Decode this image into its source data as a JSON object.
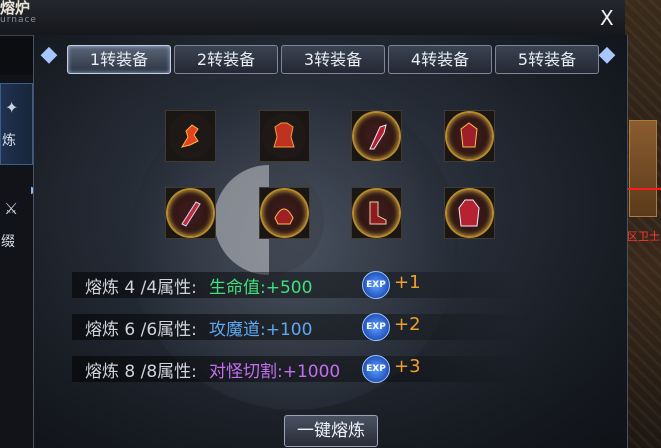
{
  "window": {
    "title": "熔炉",
    "subtitle": "urnace",
    "close_label": "X"
  },
  "sidebar": {
    "items": [
      {
        "label": "炼",
        "icon": "smelt-icon",
        "active": true
      },
      {
        "label": "缀",
        "icon": "embellish-icon",
        "active": false
      }
    ]
  },
  "tabs": [
    {
      "label": "1转装备",
      "active": true
    },
    {
      "label": "2转装备",
      "active": false
    },
    {
      "label": "3转装备",
      "active": false
    },
    {
      "label": "4转装备",
      "active": false
    },
    {
      "label": "5转装备",
      "active": false
    }
  ],
  "equipment_slots": [
    {
      "icon": "flame-weapon-icon",
      "highlight": false
    },
    {
      "icon": "red-armor-icon",
      "highlight": false
    },
    {
      "icon": "axe-icon",
      "highlight": true
    },
    {
      "icon": "armor-set-icon",
      "highlight": true
    },
    {
      "icon": "blade-icon",
      "highlight": true
    },
    {
      "icon": "helmet-icon",
      "highlight": true
    },
    {
      "icon": "boots-icon",
      "highlight": true
    },
    {
      "icon": "robe-icon",
      "highlight": true
    }
  ],
  "attributes": [
    {
      "label": "熔炼 4 /4属性:",
      "value": "生命值:+500",
      "value_color": "#3fe07a",
      "exp_icon": "EXP",
      "exp": "+1"
    },
    {
      "label": "熔炼 6 /6属性:",
      "value": "攻魔道:+100",
      "value_color": "#5fa8f0",
      "exp_icon": "EXP",
      "exp": "+2"
    },
    {
      "label": "熔炼 8 /8属性:",
      "value": "对怪切割:+1000",
      "value_color": "#c36ef0",
      "exp_icon": "EXP",
      "exp": "+3"
    }
  ],
  "smelt_button": "一键熔炼",
  "world_label": "区卫士"
}
